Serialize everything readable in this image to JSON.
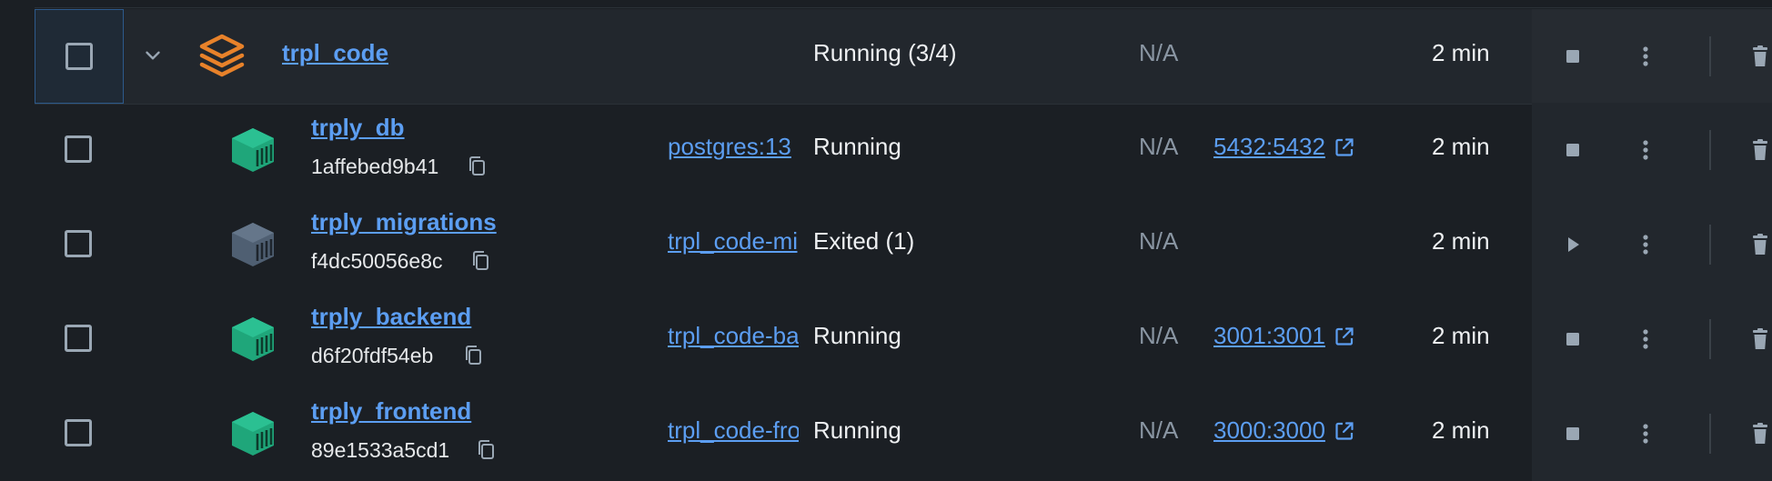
{
  "group": {
    "name": "trpl_code",
    "status": "Running (3/4)",
    "cpu": "N/A",
    "started": "2 min",
    "icon": "stack-layers-icon"
  },
  "containers": [
    {
      "name": "trply_db",
      "id": "1affebed9b41",
      "image": "postgres:13",
      "status": "Running",
      "cpu": "N/A",
      "port": "5432:5432",
      "started": "2 min",
      "state": "running"
    },
    {
      "name": "trply_migrations",
      "id": "f4dc50056e8c",
      "image": "trpl_code-migrations",
      "status": "Exited (1)",
      "cpu": "N/A",
      "port": "",
      "started": "2 min",
      "state": "exited"
    },
    {
      "name": "trply_backend",
      "id": "d6f20fdf54eb",
      "image": "trpl_code-backend",
      "status": "Running",
      "cpu": "N/A",
      "port": "3001:3001",
      "started": "2 min",
      "state": "running"
    },
    {
      "name": "trply_frontend",
      "id": "89e1533a5cd1",
      "image": "trpl_code-frontend",
      "status": "Running",
      "cpu": "N/A",
      "port": "3000:3000",
      "started": "2 min",
      "state": "running"
    }
  ],
  "colors": {
    "background": "#1b1f24",
    "group_row": "#22272d",
    "link": "#5c9ef2",
    "running_icon": "#1fa67a",
    "exited_icon": "#4f5f72",
    "group_icon": "#e8822a",
    "muted_text": "#8a96a3",
    "action_icon": "#9aa7b4"
  }
}
